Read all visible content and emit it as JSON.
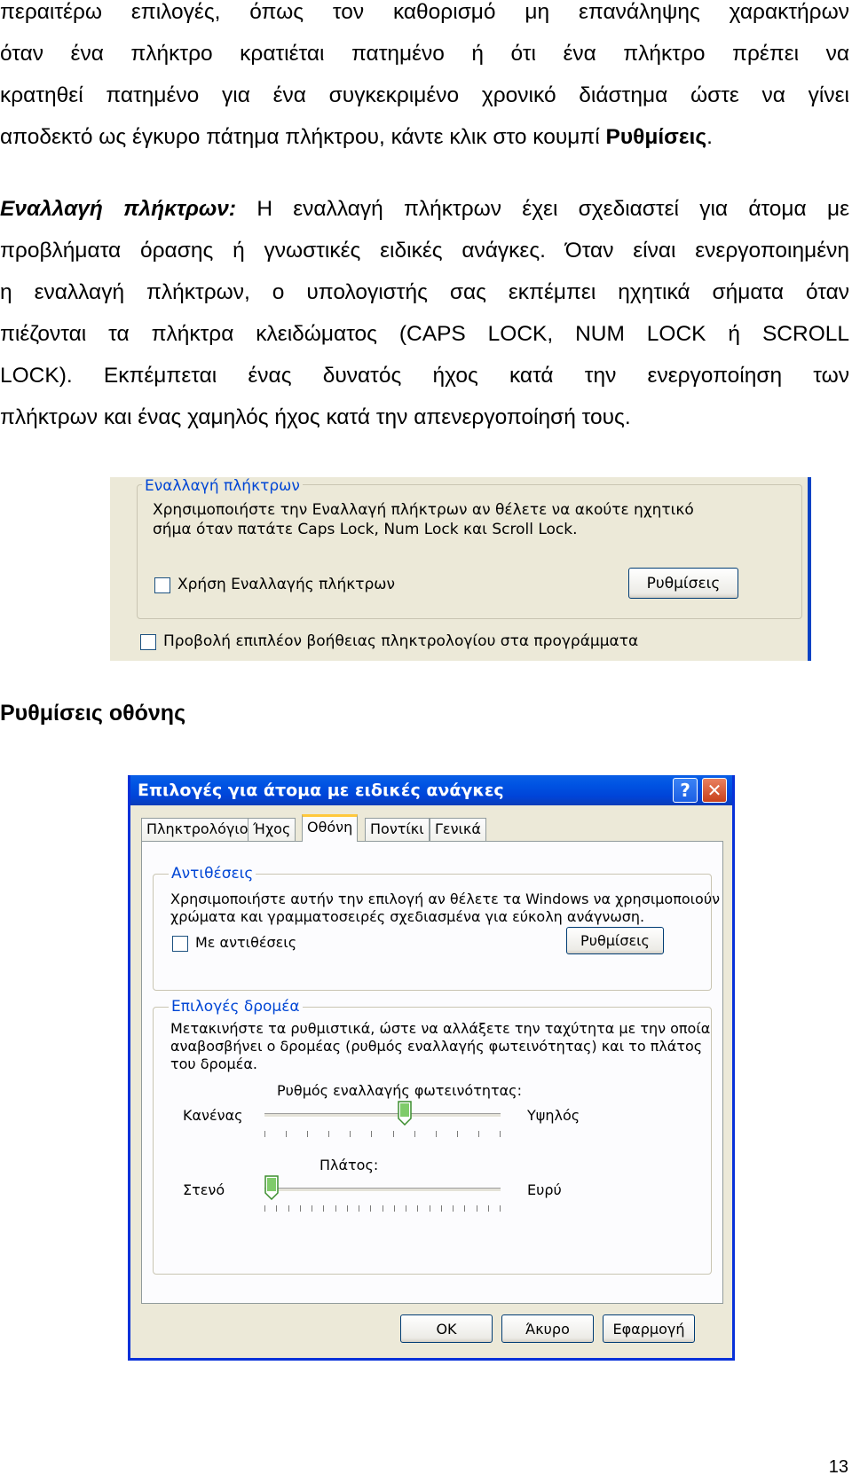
{
  "document": {
    "para1": {
      "lines": [
        "περαιτέρω επιλογές, όπως τον καθορισμό μη επανάληψης χαρακτήρων",
        "όταν ένα πλήκτρο κρατιέται πατημένο ή ότι ένα πλήκτρο πρέπει να",
        "κρατηθεί πατημένο για ένα συγκεκριμένο χρονικό διάστημα ώστε να γίνει"
      ],
      "last_line_prefix": "αποδεκτό ως έγκυρο πάτημα πλήκτρου, κάντε κλικ στο κουμπί ",
      "last_line_bold": "Ρυθμίσεις",
      "last_line_suffix": "."
    },
    "para2": {
      "lead_bold_italic": "Εναλλαγή πλήκτρων:",
      "line1_rest": " Η εναλλαγή πλήκτρων έχει σχεδιαστεί για άτομα με",
      "lines": [
        "προβλήματα όρασης ή γνωστικές ειδικές ανάγκες. Όταν είναι ενεργοποιημένη",
        "η εναλλαγή πλήκτρων, ο υπολογιστής σας εκπέμπει ηχητικά σήματα όταν",
        "πιέζονται τα πλήκτρα κλειδώματος (CAPS LOCK, NUM LOCK ή SCROLL",
        "LOCK). Εκπέμπεται ένας δυνατός ήχος κατά την ενεργοποίηση των",
        "πλήκτρων και ένας χαμηλός ήχος κατά την απενεργοποίησή τους."
      ]
    },
    "heading": "Ρυθμίσεις οθόνης",
    "page_number": "13"
  },
  "shot1": {
    "group_title": "Εναλλαγή πλήκτρων",
    "description_line1": "Χρησιμοποιήστε την Εναλλαγή πλήκτρων αν θέλετε να ακούτε ηχητικό",
    "description_line2": "σήμα όταν πατάτε Caps Lock, Num Lock και Scroll Lock.",
    "checkbox_label": "Χρήση Εναλλαγής πλήκτρων",
    "settings_button": "Ρυθμίσεις",
    "extra_help_label": "Προβολή επιπλέον βοήθειας πληκτρολογίου στα προγράμματα"
  },
  "dialog": {
    "title": "Επιλογές για άτομα με ειδικές ανάγκες",
    "help_glyph": "?",
    "close_glyph": "✕",
    "tabs": [
      "Πληκτρολόγιο",
      "Ήχος",
      "Οθόνη",
      "Ποντίκι",
      "Γενικά"
    ],
    "active_tab": "Οθόνη",
    "contrast": {
      "group_title": "Αντιθέσεις",
      "line1": "Χρησιμοποιήστε αυτήν την επιλογή αν θέλετε τα Windows να χρησιμοποιούν",
      "line2": "χρώματα και γραμματοσειρές σχεδιασμένα για εύκολη ανάγνωση.",
      "checkbox_label": "Με αντιθέσεις",
      "settings_button": "Ρυθμίσεις"
    },
    "cursor": {
      "group_title": "Επιλογές δρομέα",
      "line1": "Μετακινήστε τα ρυθμιστικά, ώστε να αλλάξετε την ταχύτητα με την οποία",
      "line2": "αναβοσβήνει ο δρομέας (ρυθμός εναλλαγής φωτεινότητας) και το πλάτος",
      "line3": "του δρομέα.",
      "blink_label": "Ρυθμός εναλλαγής φωτεινότητας:",
      "blink_min": "Κανένας",
      "blink_max": "Υψηλός",
      "blink_value": 0.6,
      "width_label": "Πλάτος:",
      "width_min": "Στενό",
      "width_max": "Ευρύ",
      "width_value": 0
    },
    "buttons": {
      "ok": "OK",
      "cancel": "Άκυρο",
      "apply": "Εφαρμογή"
    }
  }
}
